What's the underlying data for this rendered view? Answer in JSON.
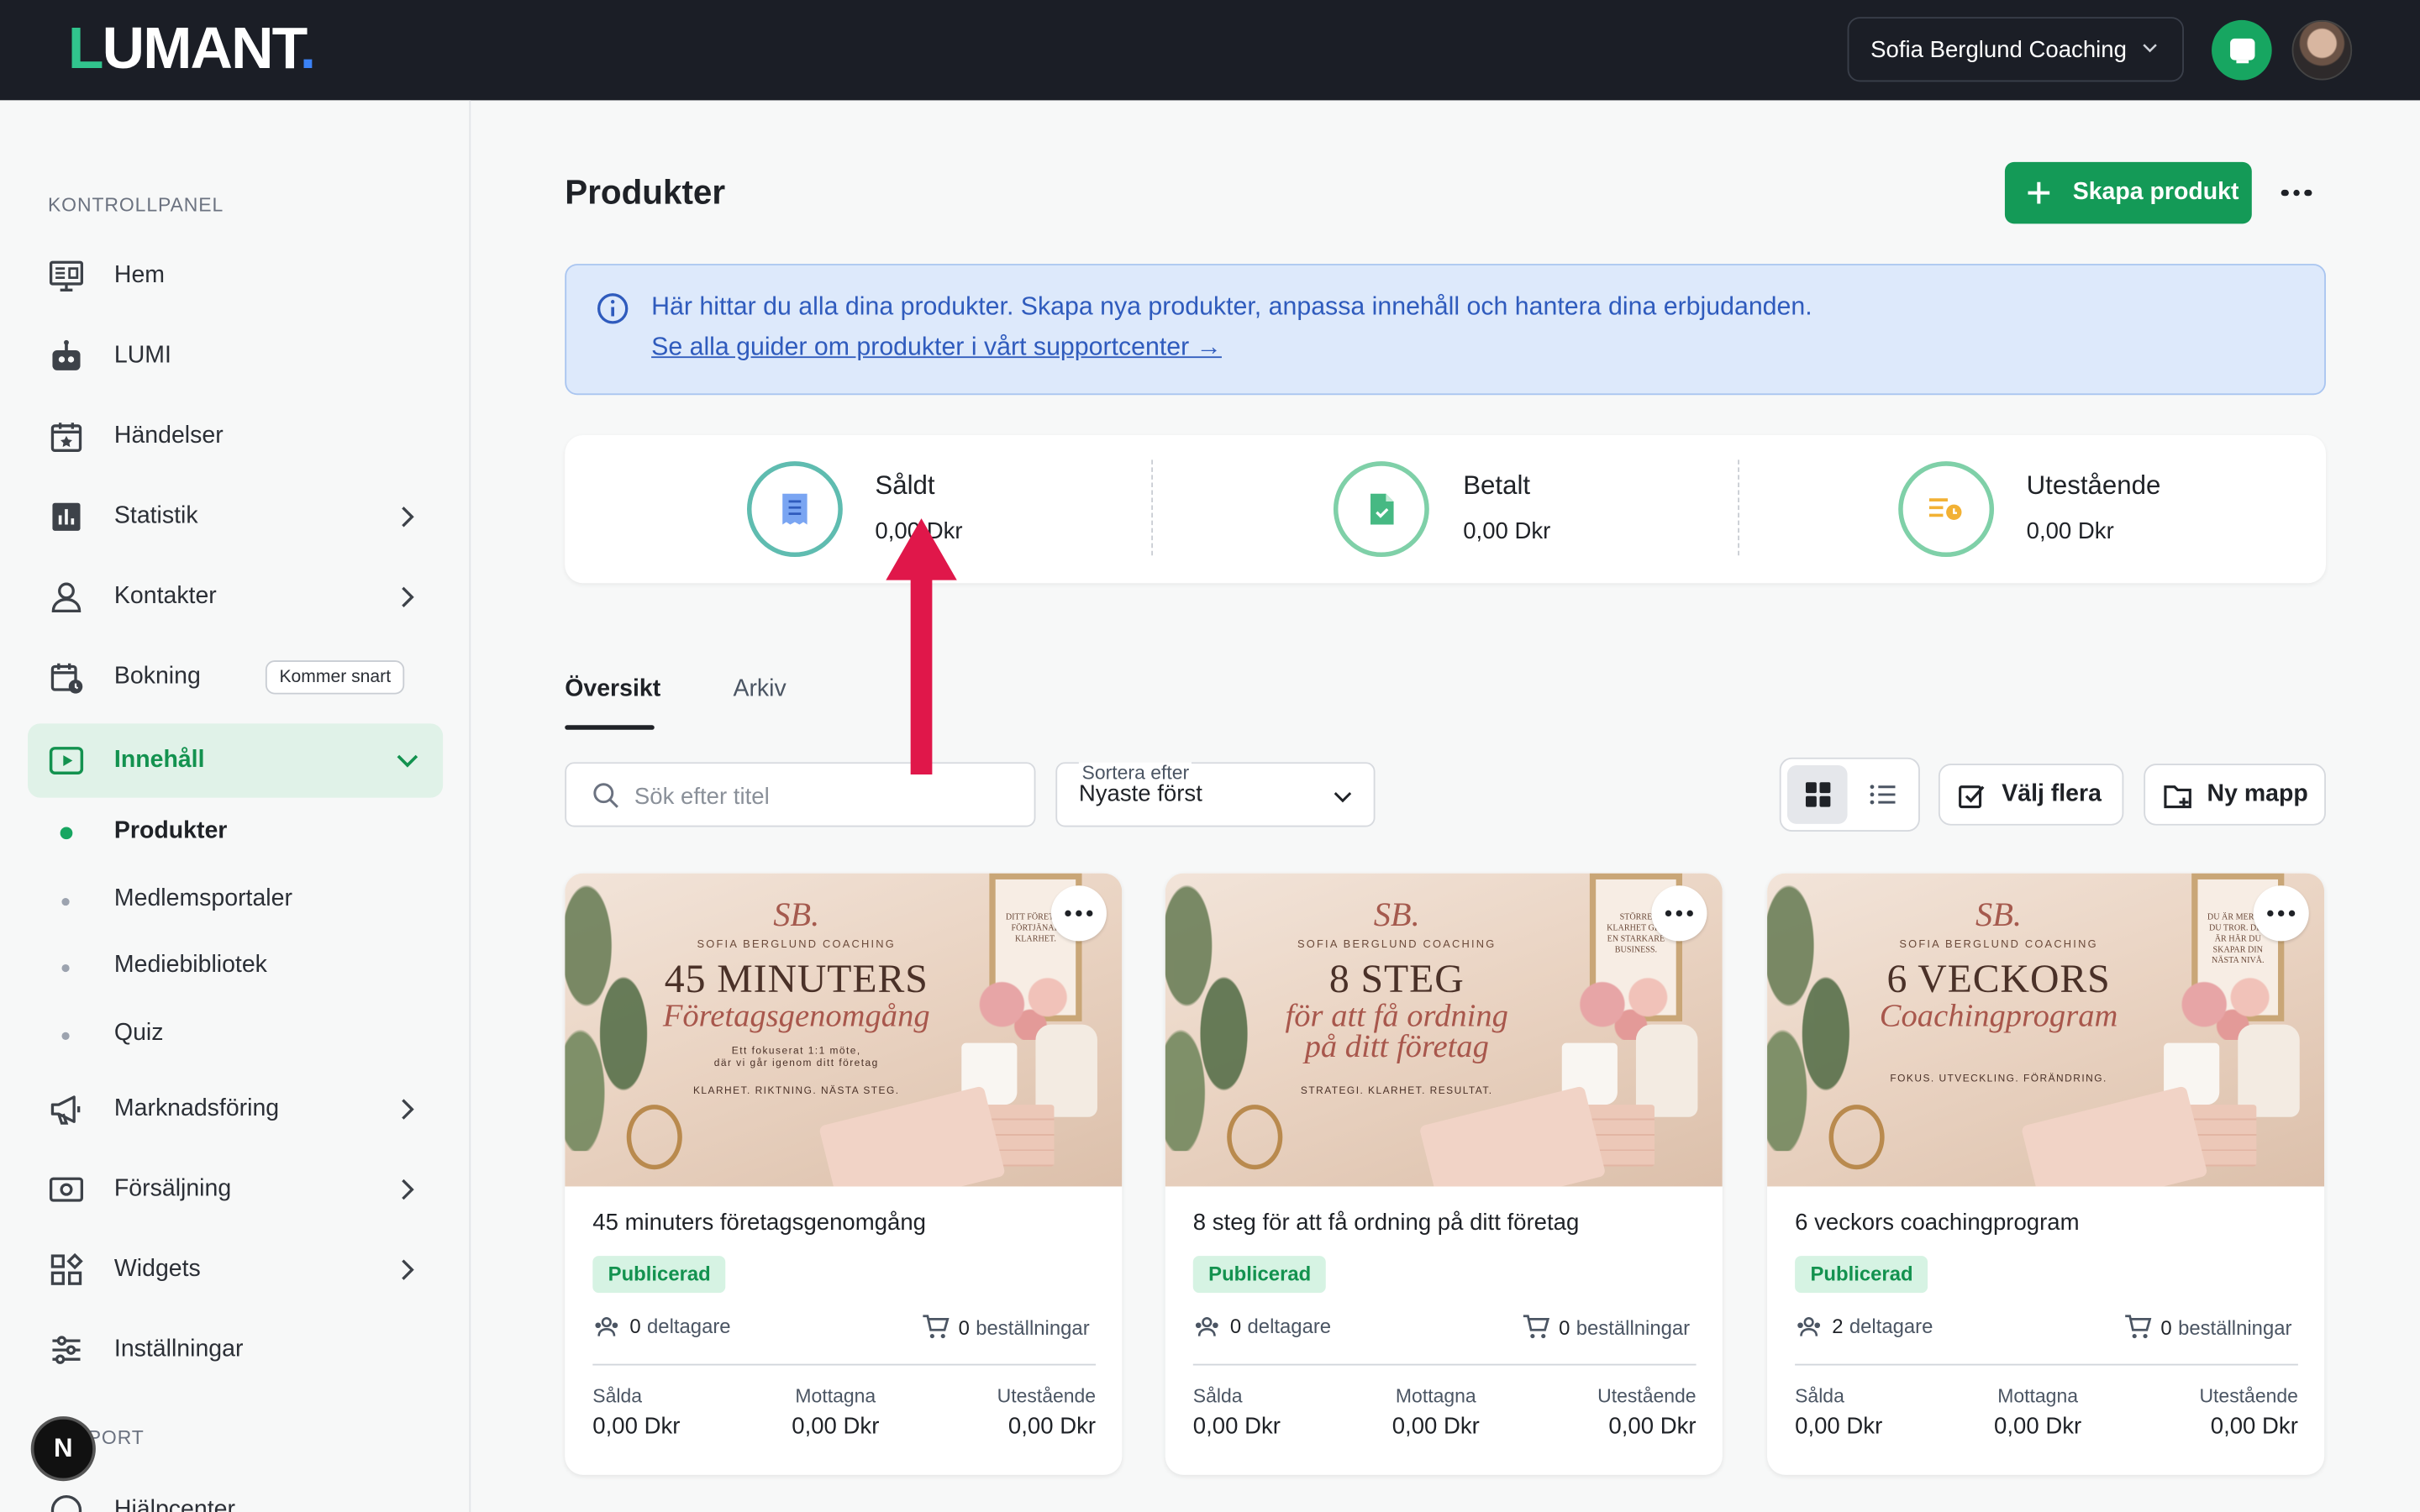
{
  "header": {
    "logo": {
      "prefix": "L",
      "rest": "UMANT",
      "dot": "."
    },
    "org_name": "Sofia Berglund Coaching"
  },
  "sidebar": {
    "section_main": "KONTROLLPANEL",
    "items": [
      {
        "label": "Hem",
        "icon": "dashboard-icon"
      },
      {
        "label": "LUMI",
        "icon": "robot-icon"
      },
      {
        "label": "Händelser",
        "icon": "calendar-star-icon"
      },
      {
        "label": "Statistik",
        "icon": "bar-chart-icon"
      },
      {
        "label": "Kontakter",
        "icon": "person-icon"
      },
      {
        "label": "Bokning",
        "icon": "calendar-clock-icon",
        "badge": "Kommer snart"
      },
      {
        "label": "Innehåll",
        "icon": "play-square-icon"
      },
      {
        "label": "Marknadsföring",
        "icon": "megaphone-icon"
      },
      {
        "label": "Försäljning",
        "icon": "money-icon"
      },
      {
        "label": "Widgets",
        "icon": "widgets-icon"
      },
      {
        "label": "Inställningar",
        "icon": "sliders-icon"
      }
    ],
    "sub_items": [
      "Produkter",
      "Medlemsportaler",
      "Mediebibliotek",
      "Quiz"
    ],
    "section_support": "PORT",
    "help_label": "Hjälpcenter",
    "n_badge": "N"
  },
  "main": {
    "title": "Produkter",
    "create_label": "Skapa produkt",
    "info": {
      "text": "Här hittar du alla dina produkter. Skapa nya produkter, anpassa innehåll och hantera dina erbjudanden.",
      "link": "Se alla guider om produkter i vårt supportcenter →"
    },
    "stats": [
      {
        "name": "Såldt",
        "value": "0,00 Dkr",
        "icon": "receipt-icon"
      },
      {
        "name": "Betalt",
        "value": "0,00 Dkr",
        "icon": "document-check-icon"
      },
      {
        "name": "Utestående",
        "value": "0,00 Dkr",
        "icon": "pending-list-icon"
      }
    ],
    "tabs": [
      "Översikt",
      "Arkiv"
    ],
    "search_placeholder": "Sök efter titel",
    "sort_caption": "Sortera efter",
    "sort_value": "Nyaste först",
    "select_many": "Välj flera",
    "new_folder": "Ny mapp"
  },
  "products": [
    {
      "title": "45 minuters företagsgenomgång",
      "status": "Publicerad",
      "participants": "0",
      "participants_label": "deltagare",
      "orders": "0",
      "orders_label": "beställningar",
      "cols": [
        {
          "label": "Sålda",
          "value": "0,00 Dkr"
        },
        {
          "label": "Mottagna",
          "value": "0,00 Dkr"
        },
        {
          "label": "Utestående",
          "value": "0,00 Dkr"
        }
      ],
      "img": {
        "monogram": "SB.",
        "brand": "SOFIA BERGLUND COACHING",
        "big": "45 MINUTERS",
        "script": "Företagsgenomgång",
        "line1": "Ett fokuserat 1:1 möte,",
        "line2": "där vi går igenom ditt företag",
        "tagline": "KLARHET. RIKTNING. NÄSTA STEG.",
        "frame": "DITT FÖRETAG FÖRTJÄNAR KLARHET."
      }
    },
    {
      "title": "8 steg för att få ordning på ditt företag",
      "status": "Publicerad",
      "participants": "0",
      "participants_label": "deltagare",
      "orders": "0",
      "orders_label": "beställningar",
      "cols": [
        {
          "label": "Sålda",
          "value": "0,00 Dkr"
        },
        {
          "label": "Mottagna",
          "value": "0,00 Dkr"
        },
        {
          "label": "Utestående",
          "value": "0,00 Dkr"
        }
      ],
      "img": {
        "monogram": "SB.",
        "brand": "SOFIA BERGLUND COACHING",
        "big": "8 STEG",
        "script": "för att få ordning",
        "script2": "på ditt företag",
        "tagline": "STRATEGI. KLARHET. RESULTAT.",
        "frame": "STÖRRE KLARHET GER EN STARKARE BUSINESS."
      }
    },
    {
      "title": "6 veckors coachingprogram",
      "status": "Publicerad",
      "participants": "2",
      "participants_label": "deltagare",
      "orders": "0",
      "orders_label": "beställningar",
      "cols": [
        {
          "label": "Sålda",
          "value": "0,00 Dkr"
        },
        {
          "label": "Mottagna",
          "value": "0,00 Dkr"
        },
        {
          "label": "Utestående",
          "value": "0,00 Dkr"
        }
      ],
      "img": {
        "monogram": "SB.",
        "brand": "SOFIA BERGLUND COACHING",
        "big": "6 VECKORS",
        "script": "Coachingprogram",
        "tagline": "FOKUS. UTVECKLING. FÖRÄNDRING.",
        "frame": "DU ÄR MER ÄN DU TROR. DET ÄR HÄR DU SKAPAR DIN NÄSTA NIVÅ."
      }
    }
  ],
  "colors": {
    "brand_green": "#149a57",
    "annotation_arrow": "#e0174a",
    "topbar": "#1b1e26"
  }
}
